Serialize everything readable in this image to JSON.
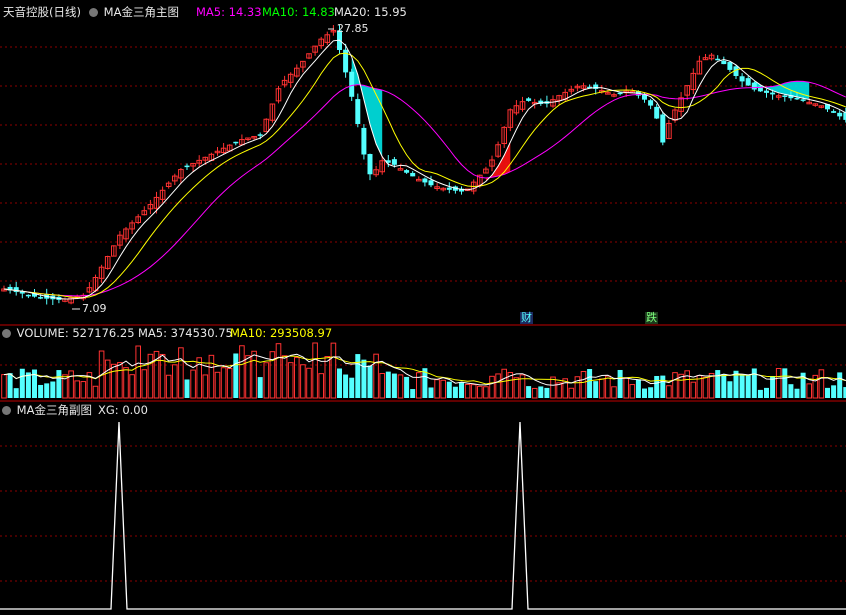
{
  "main_header": {
    "stock_name": "天音控股(日线)",
    "indicator_name": "MA金三角主图",
    "ma5": "MA5: 14.33",
    "ma10": "MA10: 14.83",
    "ma20": "MA20: 15.95"
  },
  "volume_header": {
    "volume": "VOLUME: 527176.25",
    "ma5": "MA5: 374530.75",
    "ma10": "MA10: 293508.97"
  },
  "sub_header": {
    "indicator_name": "MA金三角副图",
    "xg": "XG: 0.00"
  },
  "annotations": {
    "high_label": "27.85",
    "low_label": "7.09",
    "event_cai": "财",
    "event_die": "跌"
  },
  "colors": {
    "up": "#ff3232",
    "down": "#54ffff",
    "ma5": "#ffffff",
    "ma10": "#ffff00",
    "ma20": "#ff00ff",
    "ma5_label": "#ff00ff",
    "ma10_label": "#00ff00",
    "ma20_label": "#ffffff",
    "grid": "#8b0000",
    "divider": "#c00000",
    "cyan_fill": "#00e5e5",
    "red_fill": "#ff1010"
  },
  "chart_data": [
    {
      "type": "candlestick",
      "series": [
        {
          "name": "MA5",
          "values": [
            14.33
          ]
        },
        {
          "name": "MA10",
          "values": [
            14.83
          ]
        },
        {
          "name": "MA20",
          "values": [
            15.95
          ]
        }
      ],
      "annotations": [
        "27.85",
        "7.09",
        "财",
        "跌"
      ],
      "grid": true
    },
    {
      "type": "bar",
      "series": [
        {
          "name": "VOLUME",
          "values": [
            527176.25
          ]
        },
        {
          "name": "MA5",
          "values": [
            374530.75
          ]
        },
        {
          "name": "MA10",
          "values": [
            293508.97
          ]
        }
      ],
      "grid": true
    },
    {
      "type": "line",
      "series": [
        {
          "name": "XG",
          "values": [
            0,
            1,
            0,
            1,
            0
          ]
        }
      ],
      "grid": true
    }
  ]
}
